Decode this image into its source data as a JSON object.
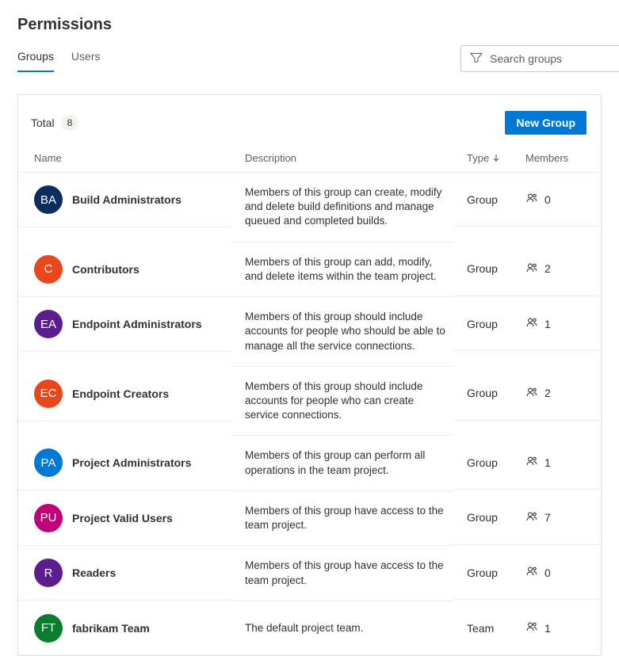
{
  "title": "Permissions",
  "tabs": {
    "groups": "Groups",
    "users": "Users"
  },
  "search": {
    "placeholder": "Search groups"
  },
  "panel": {
    "total_label": "Total",
    "total_count": "8",
    "new_group": "New Group"
  },
  "columns": {
    "name": "Name",
    "description": "Description",
    "type": "Type",
    "members": "Members"
  },
  "rows": [
    {
      "initials": "BA",
      "color": "#0b2e5c",
      "name": "Build Administrators",
      "description": "Members of this group can create, modify and delete build definitions and manage queued and completed builds.",
      "type": "Group",
      "members": "0"
    },
    {
      "initials": "C",
      "color": "#e8461b",
      "name": "Contributors",
      "description": "Members of this group can add, modify, and delete items within the team project.",
      "type": "Group",
      "members": "2"
    },
    {
      "initials": "EA",
      "color": "#5c1d8f",
      "name": "Endpoint Administrators",
      "description": "Members of this group should include accounts for people who should be able to manage all the service connections.",
      "type": "Group",
      "members": "1"
    },
    {
      "initials": "EC",
      "color": "#e8461b",
      "name": "Endpoint Creators",
      "description": "Members of this group should include accounts for people who can create service connections.",
      "type": "Group",
      "members": "2"
    },
    {
      "initials": "PA",
      "color": "#0078d4",
      "name": "Project Administrators",
      "description": "Members of this group can perform all operations in the team project.",
      "type": "Group",
      "members": "1"
    },
    {
      "initials": "PU",
      "color": "#bf0077",
      "name": "Project Valid Users",
      "description": "Members of this group have access to the team project.",
      "type": "Group",
      "members": "7"
    },
    {
      "initials": "R",
      "color": "#5c1d8f",
      "name": "Readers",
      "description": "Members of this group have access to the team project.",
      "type": "Group",
      "members": "0"
    },
    {
      "initials": "FT",
      "color": "#0b7d2e",
      "name": "fabrikam Team",
      "description": "The default project team.",
      "type": "Team",
      "members": "1"
    }
  ]
}
